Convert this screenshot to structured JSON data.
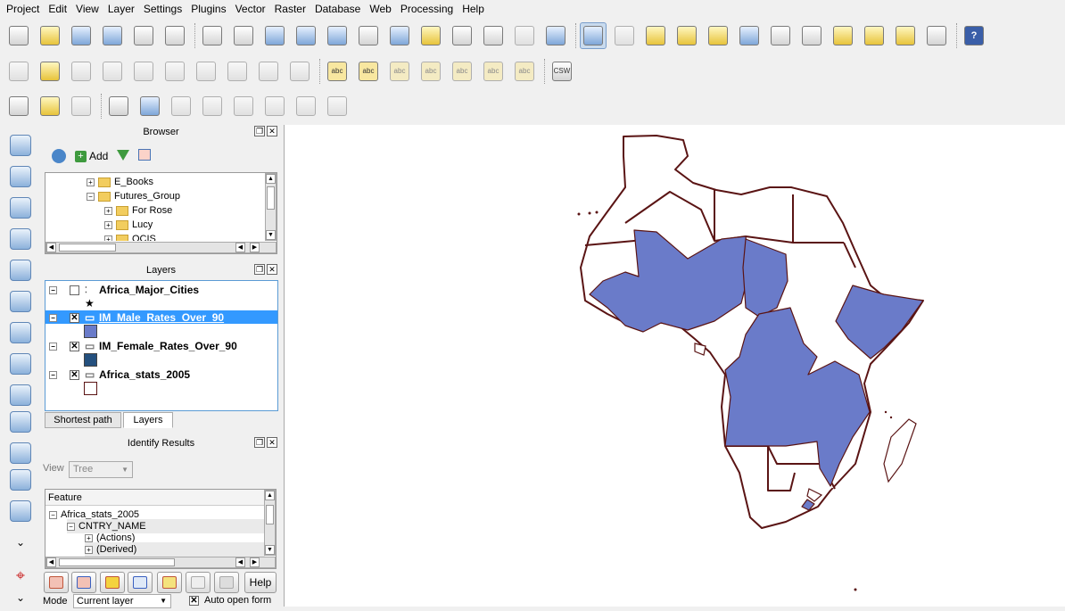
{
  "menubar": [
    "Project",
    "Edit",
    "View",
    "Layer",
    "Settings",
    "Plugins",
    "Vector",
    "Raster",
    "Database",
    "Web",
    "Processing",
    "Help"
  ],
  "toolbar": {
    "csw_label": "CSW",
    "abc_label": "abc",
    "help_label": "?"
  },
  "browser": {
    "title": "Browser",
    "add_label": "Add",
    "items": [
      {
        "label": "E_Books",
        "expanded": false
      },
      {
        "label": "Futures_Group",
        "expanded": true
      },
      {
        "label": "For Rose",
        "expanded": false
      },
      {
        "label": "Lucy",
        "expanded": false
      },
      {
        "label": "OCIS",
        "expanded": false
      }
    ]
  },
  "layers": {
    "title": "Layers",
    "items": [
      {
        "name": "Africa_Major_Cities",
        "checked": false,
        "selected": false,
        "symbol": "★"
      },
      {
        "name": "IM_Male_Rates_Over_90",
        "checked": true,
        "selected": true,
        "color": "#6a7bc9"
      },
      {
        "name": "IM_Female_Rates_Over_90",
        "checked": true,
        "selected": false,
        "color": "#24507e"
      },
      {
        "name": "Africa_stats_2005",
        "checked": true,
        "selected": false,
        "color": "#ffffff"
      }
    ],
    "tabs": [
      "Shortest path",
      "Layers"
    ]
  },
  "identify": {
    "title": "Identify Results",
    "view_label": "View",
    "view_value": "Tree",
    "column_header": "Feature",
    "tree": [
      "Africa_stats_2005",
      "CNTRY_NAME",
      "(Actions)",
      "(Derived)"
    ],
    "help_label": "Help",
    "mode_label": "Mode",
    "mode_value": "Current layer",
    "auto_open_label": "Auto open form"
  },
  "map": {
    "fill_color": "#6a7bc9",
    "border_color": "#5a1414"
  }
}
